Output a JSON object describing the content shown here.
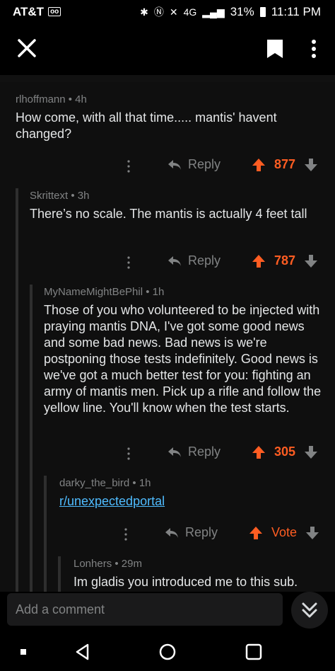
{
  "status_bar": {
    "carrier": "AT&T",
    "voicemail": "oo",
    "network": "4G",
    "battery_percent": "31%",
    "time": "11:11 PM"
  },
  "app_bar": {
    "icons": [
      "close-icon",
      "bookmark-icon",
      "more-vertical-icon"
    ]
  },
  "comments": [
    {
      "meta": "rlhoffmann • 4h",
      "body": "How come, with all that time..... mantis' havent changed?",
      "reply_label": "Reply",
      "score": "877"
    },
    {
      "meta": "Skrittext • 3h",
      "body": "There’s no scale.  The mantis is actually 4 feet tall",
      "reply_label": "Reply",
      "score": "787"
    },
    {
      "meta": "MyNameMightBePhil • 1h",
      "body": "Those of you who volunteered to be injected with praying mantis DNA, I've got some good news and some bad news. Bad news is we're postponing those tests indefinitely. Good news is we've got a much better test for you: fighting an army of mantis men. Pick up a rifle and follow the yellow line. You'll know when the test starts.",
      "reply_label": "Reply",
      "score": "305"
    },
    {
      "meta": "darky_the_bird • 1h",
      "body": "r/unexpectedportal",
      "reply_label": "Reply",
      "score": "Vote"
    },
    {
      "meta": "Lonhers • 29m",
      "body": "Im gladis you introduced me to this sub."
    }
  ],
  "composer": {
    "placeholder": "Add a comment"
  },
  "colors": {
    "background": "#000000",
    "upvote": "#ff5d22",
    "link": "#4fbcff",
    "meta": "#818384"
  }
}
